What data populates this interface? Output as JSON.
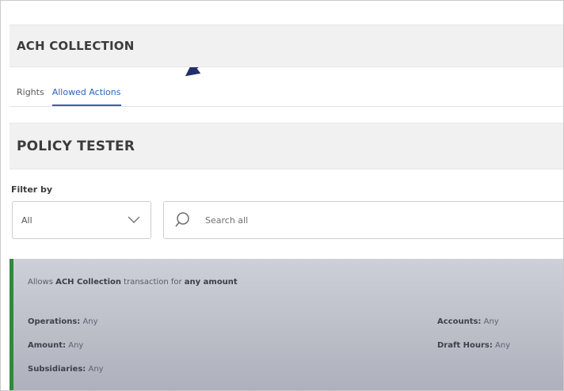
{
  "ach_collection": {
    "title": "ACH COLLECTION"
  },
  "tabs": [
    {
      "label": "Rights",
      "active": false
    },
    {
      "label": "Allowed Actions",
      "active": true
    }
  ],
  "policy_tester": {
    "title": "POLICY TESTER"
  },
  "filter": {
    "label": "Filter by",
    "selected": "All",
    "search_placeholder": "Search all"
  },
  "policy": {
    "prefix": "Allows ",
    "action": "ACH Collection",
    "middle": " transaction for ",
    "amount": "any amount",
    "fields": {
      "operations": {
        "label": "Operations:",
        "value": " Any"
      },
      "amount": {
        "label": "Amount:",
        "value": " Any"
      },
      "subsidiaries": {
        "label": "Subsidiaries:",
        "value": " Any"
      },
      "accounts": {
        "label": "Accounts:",
        "value": " Any"
      },
      "draft_hours": {
        "label": "Draft Hours:",
        "value": " Any"
      }
    }
  },
  "colors": {
    "accent": "#2c63b9",
    "card_border": "#2e8b3a",
    "arrow": "#1f2f6b"
  }
}
